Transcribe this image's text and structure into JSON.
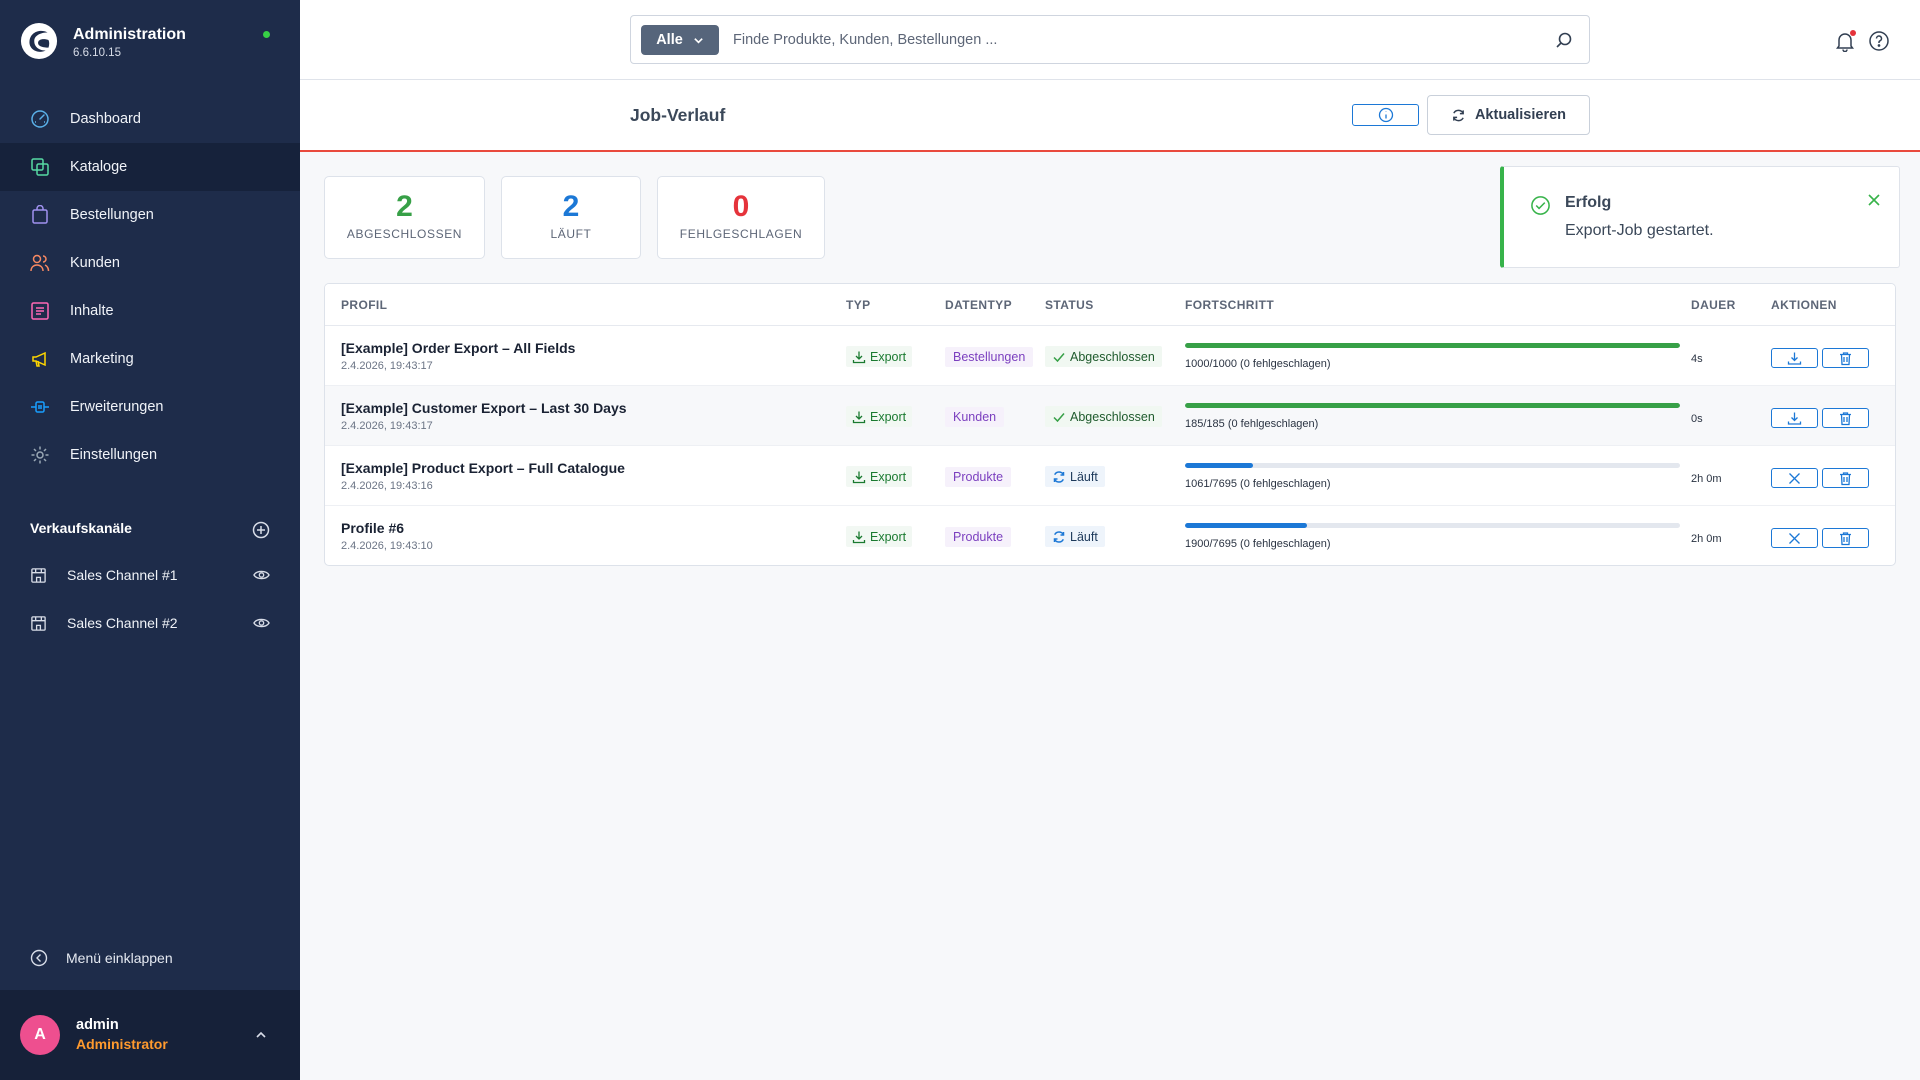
{
  "brand": {
    "title": "Administration",
    "version": "6.6.10.15"
  },
  "nav": [
    {
      "label": "Dashboard",
      "icon": "gauge-icon",
      "color": "#5ab0e8"
    },
    {
      "label": "Kataloge",
      "icon": "catalog-icon",
      "color": "#57d9a3",
      "active": true
    },
    {
      "label": "Bestellungen",
      "icon": "shopping-bag-icon",
      "color": "#a092f0"
    },
    {
      "label": "Kunden",
      "icon": "users-icon",
      "color": "#f88962"
    },
    {
      "label": "Inhalte",
      "icon": "content-icon",
      "color": "#ff68b4"
    },
    {
      "label": "Marketing",
      "icon": "megaphone-icon",
      "color": "#ffd700"
    },
    {
      "label": "Erweiterungen",
      "icon": "plug-icon",
      "color": "#189eff"
    },
    {
      "label": "Einstellungen",
      "icon": "gear-icon",
      "color": "#9aa8b5"
    }
  ],
  "channels": {
    "heading": "Verkaufskanäle",
    "items": [
      {
        "label": "Sales Channel #1"
      },
      {
        "label": "Sales Channel #2"
      }
    ]
  },
  "collapse_label": "Menü einklappen",
  "user": {
    "initial": "A",
    "name": "admin",
    "role": "Administrator"
  },
  "search": {
    "type": "Alle",
    "placeholder": "Finde Produkte, Kunden, Bestellungen ..."
  },
  "page": {
    "title": "Job-Verlauf",
    "refresh_label": "Aktualisieren"
  },
  "stats": [
    {
      "value": "2",
      "label": "ABGESCHLOSSEN",
      "color": "#37a047"
    },
    {
      "value": "2",
      "label": "LÄUFT",
      "color": "#1c78d6"
    },
    {
      "value": "0",
      "label": "FEHLGESCHLAGEN",
      "color": "#e5333b"
    }
  ],
  "toast": {
    "title": "Erfolg",
    "message": "Export-Job gestartet."
  },
  "table": {
    "headers": {
      "profile": "PROFIL",
      "type": "TYP",
      "datatype": "DATENTYP",
      "status": "STATUS",
      "progress": "FORTSCHRITT",
      "duration": "DAUER",
      "actions": "AKTIONEN"
    },
    "rows": [
      {
        "name": "[Example] Order Export – All Fields",
        "date": "2.4.2026, 19:43:17",
        "type": "Export",
        "datatype": "Bestellungen",
        "status": "Abgeschlossen",
        "state": "done",
        "progress": 1.0,
        "progress_text": "1000/1000 (0 fehlgeschlagen)",
        "duration": "4s"
      },
      {
        "name": "[Example] Customer Export – Last 30 Days",
        "date": "2.4.2026, 19:43:17",
        "type": "Export",
        "datatype": "Kunden",
        "status": "Abgeschlossen",
        "state": "done",
        "progress": 1.0,
        "progress_text": "185/185 (0 fehlgeschlagen)",
        "duration": "0s"
      },
      {
        "name": "[Example] Product Export – Full Catalogue",
        "date": "2.4.2026, 19:43:16",
        "type": "Export",
        "datatype": "Produkte",
        "status": "Läuft",
        "state": "running",
        "progress": 0.138,
        "progress_text": "1061/7695 (0 fehlgeschlagen)",
        "duration": "2h 0m"
      },
      {
        "name": "Profile #6",
        "date": "2.4.2026, 19:43:10",
        "type": "Export",
        "datatype": "Produkte",
        "status": "Läuft",
        "state": "running",
        "progress": 0.247,
        "progress_text": "1900/7695 (0 fehlgeschlagen)",
        "duration": "2h 0m"
      }
    ]
  },
  "colors": {
    "done_fill": "#37a047",
    "running_fill": "#1c78d6",
    "accent": "#1c78d6"
  }
}
